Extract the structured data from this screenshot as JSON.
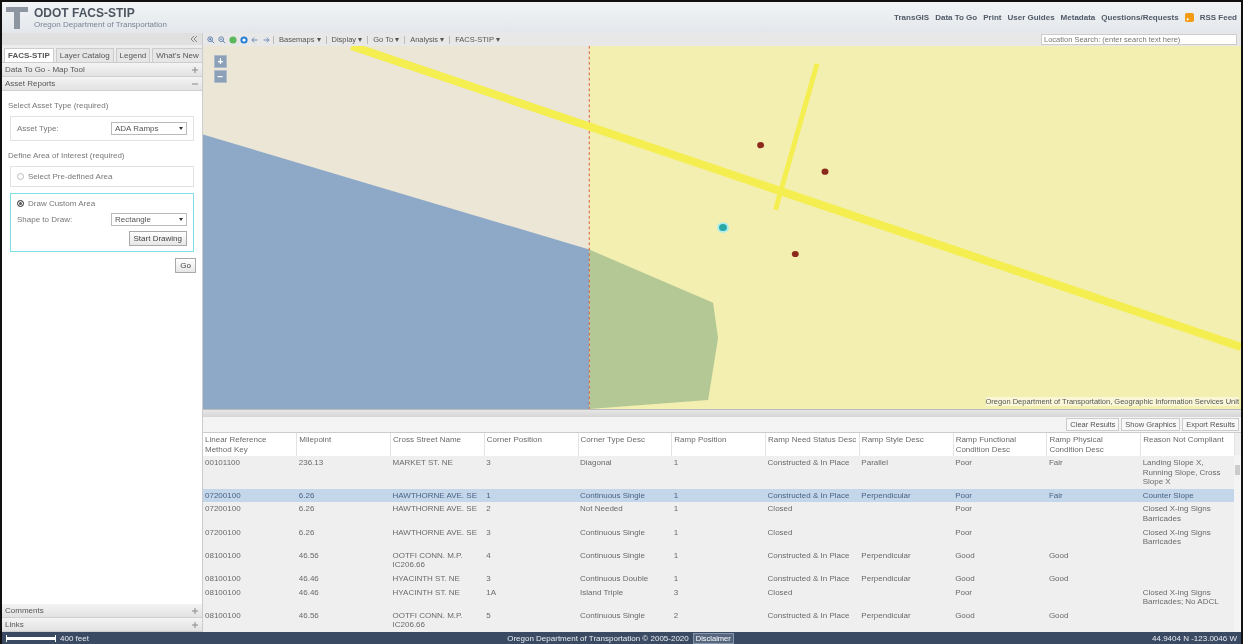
{
  "header": {
    "title": "ODOT FACS-STIP",
    "subtitle": "Oregon Department of Transportation",
    "links": [
      "TransGIS",
      "Data To Go",
      "Print",
      "User Guides",
      "Metadata",
      "Questions/Requests"
    ],
    "rss": "RSS Feed"
  },
  "toolbar": {
    "menus": [
      "Basemaps ▾",
      "Display ▾",
      "Go To ▾",
      "Analysis ▾",
      "FACS-STIP ▾"
    ],
    "search": {
      "placeholder": "Location Search: (enter search text here)"
    }
  },
  "sidebar": {
    "tabs": [
      {
        "label": "FACS-STIP",
        "selected": true
      },
      {
        "label": "Layer Catalog",
        "selected": false
      },
      {
        "label": "Legend",
        "selected": false
      },
      {
        "label": "What's New",
        "selected": false
      }
    ],
    "sections": [
      {
        "title": "Data To Go - Map Tool",
        "expanded": false
      },
      {
        "title": "Asset Reports",
        "expanded": true
      }
    ],
    "asset_heading": "Select Asset Type (required)",
    "asset_label": "Asset Type:",
    "asset_value": "ADA Ramps",
    "area_heading": "Define Area of Interest (required)",
    "options": [
      {
        "label": "Select Pre-defined Area",
        "selected": false
      },
      {
        "label": "Draw Custom Area",
        "selected": true
      }
    ],
    "shape_label": "Shape to Draw:",
    "shape_value": "Rectangle",
    "start_button": "Start Drawing",
    "go_button": "Go",
    "bottom_sections": [
      {
        "title": "Comments",
        "expanded": false
      },
      {
        "title": "Links",
        "expanded": false
      }
    ]
  },
  "map": {
    "zoom_in": "+",
    "zoom_out": "−",
    "attribution": "Oregon Department of Transportation, Geographic Information Services Unit"
  },
  "results": {
    "buttons": [
      "Clear Results",
      "Show Graphics",
      "Export Results"
    ],
    "columns": [
      "Linear Reference Method Key",
      "Milepoint",
      "Cross Street Name",
      "Corner Position",
      "Corner Type Desc",
      "Ramp Position",
      "Ramp Need Status Desc",
      "Ramp Style Desc",
      "Ramp Functional Condition Desc",
      "Ramp Physical Condition Desc",
      "Reason Not Compliant"
    ],
    "rows": [
      {
        "selected": false,
        "cells": [
          "00101100",
          "236.13",
          "MARKET ST. NE",
          "3",
          "Diagonal",
          "1",
          "Constructed & In Place",
          "Parallel",
          "Poor",
          "Fair",
          "Landing Slope X, Running Slope, Cross Slope X"
        ]
      },
      {
        "selected": true,
        "cells": [
          "07200100",
          "6.26",
          "HAWTHORNE AVE. SE",
          "1",
          "Continuous Single",
          "1",
          "Constructed & In Place",
          "Perpendicular",
          "Poor",
          "Fair",
          "Counter Slope"
        ]
      },
      {
        "selected": false,
        "cells": [
          "07200100",
          "6.26",
          "HAWTHORNE AVE. SE",
          "2",
          "Not Needed",
          "1",
          "Closed",
          null,
          "Poor",
          null,
          "Closed X-ing Signs Barricades"
        ]
      },
      {
        "selected": false,
        "cells": [
          "07200100",
          "6.26",
          "HAWTHORNE AVE. SE",
          "3",
          "Continuous Single",
          "1",
          "Closed",
          null,
          "Poor",
          null,
          "Closed X-ing Signs Barricades"
        ]
      },
      {
        "selected": false,
        "cells": [
          "08100100",
          "46.56",
          "OOTFI CONN. M.P. IC206.66",
          "4",
          "Continuous Single",
          "1",
          "Constructed & In Place",
          "Perpendicular",
          "Good",
          "Good",
          null
        ]
      },
      {
        "selected": false,
        "cells": [
          "08100100",
          "46.46",
          "HYACINTH ST. NE",
          "3",
          "Continuous Double",
          "1",
          "Constructed & In Place",
          "Perpendicular",
          "Good",
          "Good",
          null
        ]
      },
      {
        "selected": false,
        "cells": [
          "08100100",
          "46.46",
          "HYACINTH ST. NE",
          "1A",
          "Island Triple",
          "3",
          "Closed",
          null,
          "Poor",
          null,
          "Closed X-ing Signs Barricades; No ADCL"
        ]
      },
      {
        "selected": false,
        "cells": [
          "08100100",
          "46.56",
          "OOTFI CONN. M.P. IC206.66",
          "5",
          "Continuous Single",
          "2",
          "Constructed & In Place",
          "Perpendicular",
          "Good",
          "Good",
          null
        ]
      }
    ]
  },
  "footer": {
    "scale": "400 feet",
    "copyright": "Oregon Department of Transportation © 2005-2020",
    "disclaimer": "Disclaimer",
    "coordinates": "44.9404 N  -123.0046 W"
  }
}
